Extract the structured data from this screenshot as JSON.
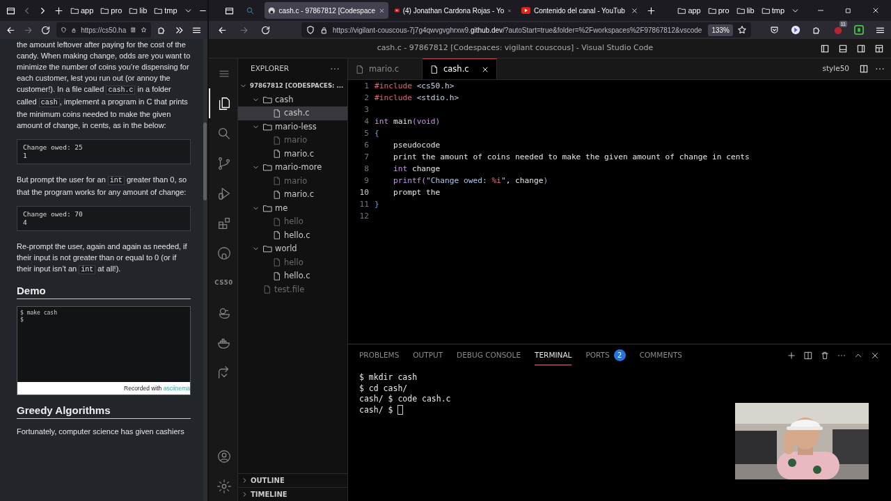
{
  "left_browser": {
    "tab_scroll": [
      {
        "kind": "left",
        "disabled": true
      },
      {
        "kind": "right",
        "disabled": false
      }
    ],
    "bookmarks": [
      "app",
      "pro",
      "lib",
      "tmp"
    ],
    "nav_buttons": [
      {
        "kind": "back",
        "disabled": false
      },
      {
        "kind": "forward",
        "disabled": true
      },
      {
        "kind": "reload",
        "disabled": false
      }
    ],
    "url": "https://cs50.ha"
  },
  "article": [
    {
      "kind": "paragraph",
      "segments": [
        {
          "kind": "text",
          "text": "the amount leftover after paying for the cost of the candy. When making change, odds are you want to minimize the number of coins you’re dispensing for each customer, lest you run out (or annoy the customer!). In a file called "
        },
        {
          "kind": "code",
          "text": "cash.c"
        },
        {
          "kind": "text",
          "text": " in a folder called "
        },
        {
          "kind": "code",
          "text": "cash"
        },
        {
          "kind": "text",
          "text": ", implement a program in C that prints the minimum coins needed to make the given amount of change, in cents, as in the below:"
        }
      ]
    },
    {
      "kind": "codeblock",
      "lines": [
        "Change owed: 25",
        "1"
      ]
    },
    {
      "kind": "paragraph",
      "segments": [
        {
          "kind": "text",
          "text": "But prompt the user for an "
        },
        {
          "kind": "code",
          "text": "int"
        },
        {
          "kind": "text",
          "text": " greater than 0, so that the program works for any amount of change:"
        }
      ]
    },
    {
      "kind": "codeblock",
      "lines": [
        "Change owed: 70",
        "4"
      ]
    },
    {
      "kind": "paragraph",
      "segments": [
        {
          "kind": "text",
          "text": "Re-prompt the user, again and again as needed, if their input is not greater than or equal to 0 (or if their input isn’t an "
        },
        {
          "kind": "code",
          "text": "int"
        },
        {
          "kind": "text",
          "text": " at all!)."
        }
      ]
    },
    {
      "kind": "heading",
      "text": "Demo"
    },
    {
      "kind": "player",
      "lines": [
        "$ make cash",
        "$"
      ],
      "caption": "Recorded with ",
      "link": "asciinema"
    },
    {
      "kind": "heading",
      "text": "Greedy Algorithms"
    },
    {
      "kind": "paragraph",
      "segments": [
        {
          "kind": "text",
          "text": "Fortunately, computer science has given cashiers"
        }
      ]
    }
  ],
  "right_browser": {
    "tabs": [
      {
        "title": "cash.c - 97867812 [Codespace",
        "kind": "github",
        "selected": true
      },
      {
        "title": "(4) Jonathan Cardona Rojas - Yo",
        "kind": "video",
        "selected": false
      },
      {
        "title": "Contenido del canal - YouTub",
        "kind": "video",
        "selected": false
      }
    ],
    "bookmarks": [
      "app",
      "pro",
      "lib",
      "tmp"
    ],
    "nav_buttons": [
      {
        "kind": "back",
        "disabled": false
      },
      {
        "kind": "forward",
        "disabled": true
      },
      {
        "kind": "reload",
        "disabled": false
      }
    ],
    "url_host": "https://vigilant-couscous-7j7g4qwvgvghrxw9.",
    "url_domain": "github.dev",
    "url_path": "/?autoStart=true&folder=%2Fworkspaces%2F97867812&vscode",
    "zoom": "133%",
    "extension_badge": "11"
  },
  "vscode": {
    "title": "cash.c - 97867812 [Codespaces: vigilant couscous] - Visual Studio Code",
    "activity_items": [
      {
        "kind": "explorer",
        "selected": true
      },
      {
        "kind": "search",
        "selected": false
      },
      {
        "kind": "source-control",
        "selected": false
      },
      {
        "kind": "run-debug",
        "selected": false
      },
      {
        "kind": "extensions",
        "selected": false
      },
      {
        "kind": "github",
        "selected": false
      },
      {
        "kind": "cs50",
        "label": "CS50",
        "selected": false
      },
      {
        "kind": "duck",
        "selected": false
      },
      {
        "kind": "docker",
        "selected": false
      },
      {
        "kind": "remote",
        "selected": false
      }
    ],
    "explorer": {
      "header": "EXPLORER",
      "root": {
        "label": "97867812 [CODESPACES: ...",
        "expanded": true,
        "children": [
          {
            "kind": "folder",
            "label": "cash",
            "expanded": true,
            "selected": false,
            "children": [
              {
                "kind": "file",
                "label": "cash.c",
                "selected": true,
                "dimmed": false
              }
            ]
          },
          {
            "kind": "folder",
            "label": "mario-less",
            "expanded": true,
            "selected": false,
            "children": [
              {
                "kind": "file",
                "label": "mario",
                "selected": false,
                "dimmed": true
              },
              {
                "kind": "file",
                "label": "mario.c",
                "selected": false,
                "dimmed": false
              }
            ]
          },
          {
            "kind": "folder",
            "label": "mario-more",
            "expanded": true,
            "selected": false,
            "children": [
              {
                "kind": "file",
                "label": "mario",
                "selected": false,
                "dimmed": true
              },
              {
                "kind": "file",
                "label": "mario.c",
                "selected": false,
                "dimmed": false
              }
            ]
          },
          {
            "kind": "folder",
            "label": "me",
            "expanded": true,
            "selected": false,
            "children": [
              {
                "kind": "file",
                "label": "hello",
                "selected": false,
                "dimmed": true
              },
              {
                "kind": "file",
                "label": "hello.c",
                "selected": false,
                "dimmed": false
              }
            ]
          },
          {
            "kind": "folder",
            "label": "world",
            "expanded": true,
            "selected": false,
            "children": [
              {
                "kind": "file",
                "label": "hello",
                "selected": false,
                "dimmed": true
              },
              {
                "kind": "file",
                "label": "hello.c",
                "selected": false,
                "dimmed": false
              }
            ]
          },
          {
            "kind": "file",
            "label": "test.file",
            "selected": false,
            "dimmed": true
          }
        ]
      },
      "sections": [
        {
          "label": "OUTLINE",
          "expanded": false
        },
        {
          "label": "TIMELINE",
          "expanded": false
        }
      ]
    },
    "editor_tabs": [
      {
        "label": "mario.c",
        "selected": false
      },
      {
        "label": "cash.c",
        "selected": true
      }
    ],
    "style_button": "style50",
    "code_lines": [
      {
        "number": "1",
        "current": false,
        "tokens": [
          {
            "kind": "directive",
            "text": "#include"
          },
          {
            "kind": "header",
            "text": " <cs50.h>"
          }
        ]
      },
      {
        "number": "2",
        "current": false,
        "tokens": [
          {
            "kind": "directive",
            "text": "#include"
          },
          {
            "kind": "header",
            "text": " <stdio.h>"
          }
        ]
      },
      {
        "number": "3",
        "current": false
      },
      {
        "number": "4",
        "current": false,
        "tokens": [
          {
            "kind": "type",
            "text": "int"
          },
          {
            "kind": "plain",
            "text": " main"
          },
          {
            "kind": "type",
            "text": "(void)"
          }
        ]
      },
      {
        "number": "5",
        "current": false,
        "tokens": [
          {
            "kind": "bracket",
            "text": "{"
          }
        ]
      },
      {
        "number": "6",
        "current": false,
        "tokens": [
          {
            "kind": "plain",
            "text": "    pseudocode"
          }
        ]
      },
      {
        "number": "7",
        "current": false,
        "tokens": [
          {
            "kind": "plain",
            "text": "    print the amount of coins needed to make the given amount of change in cents"
          }
        ]
      },
      {
        "number": "8",
        "current": false,
        "tokens": [
          {
            "kind": "type",
            "text": "    int"
          },
          {
            "kind": "plain",
            "text": " change"
          }
        ]
      },
      {
        "number": "9",
        "current": false,
        "tokens": [
          {
            "kind": "type",
            "text": "    printf("
          },
          {
            "kind": "string",
            "text": "\"Change owed: "
          },
          {
            "kind": "format",
            "text": "%i"
          },
          {
            "kind": "string",
            "text": "\""
          },
          {
            "kind": "plain",
            "text": ", change"
          },
          {
            "kind": "type",
            "text": ")"
          }
        ]
      },
      {
        "number": "10",
        "current": true,
        "tokens": [
          {
            "kind": "plain",
            "text": "    prompt the"
          }
        ]
      },
      {
        "number": "11",
        "current": false,
        "tokens": [
          {
            "kind": "bracket",
            "text": "}"
          }
        ]
      },
      {
        "number": "12",
        "current": false
      }
    ],
    "panel": {
      "tabs": [
        {
          "label": "PROBLEMS",
          "selected": false
        },
        {
          "label": "OUTPUT",
          "selected": false
        },
        {
          "label": "DEBUG CONSOLE",
          "selected": false
        },
        {
          "label": "TERMINAL",
          "selected": true
        },
        {
          "label": "PORTS",
          "selected": false,
          "badge": "2"
        },
        {
          "label": "COMMENTS",
          "selected": false
        }
      ],
      "terminal": [
        {
          "text": "$ mkdir cash",
          "cursor": false
        },
        {
          "text": "$ cd cash/",
          "cursor": false
        },
        {
          "text": "cash/ $ code cash.c",
          "cursor": false
        },
        {
          "text": "cash/ $ ",
          "cursor": true
        }
      ]
    }
  }
}
